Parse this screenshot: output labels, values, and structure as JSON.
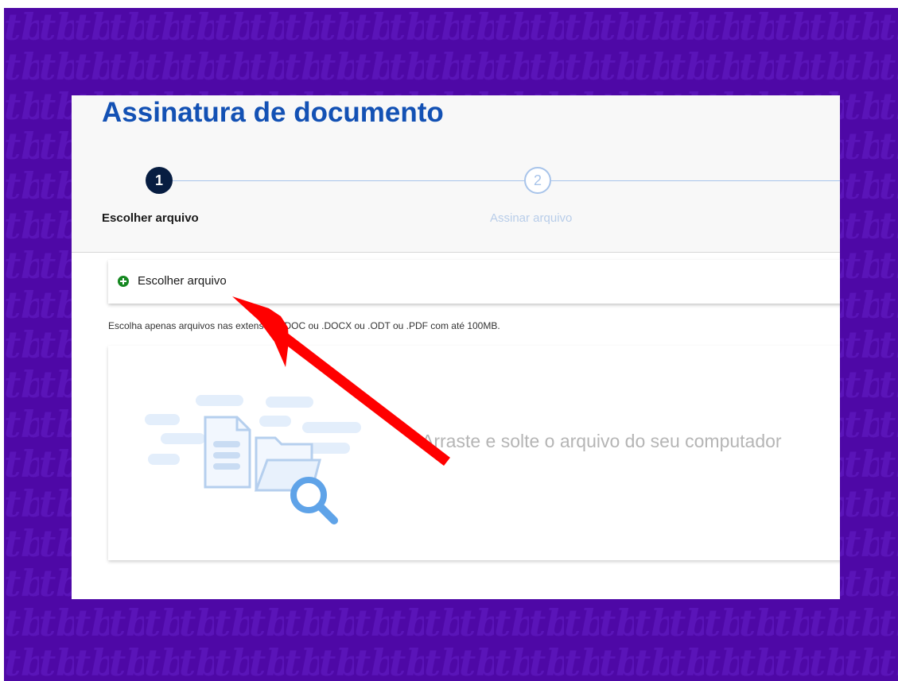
{
  "page": {
    "title": "Assinatura de documento",
    "steps": [
      {
        "number": "1",
        "label": "Escolher arquivo",
        "state": "active"
      },
      {
        "number": "2",
        "label": "Assinar arquivo",
        "state": "inactive"
      }
    ]
  },
  "upload": {
    "choose_label": "Escolher arquivo",
    "hint": "Escolha apenas arquivos nas extensões .DOC ou .DOCX ou .ODT ou .PDF com até 100MB.",
    "dropzone_text": "Arraste e solte o arquivo do seu computador"
  },
  "icons": {
    "choose": "plus-circle-icon",
    "illustration": [
      "document-icon",
      "folder-icon",
      "magnifier-icon"
    ],
    "overlay": "red-arrow"
  },
  "colors": {
    "frame_background": "#4e08a6",
    "title": "#1351b4",
    "step_active": "#071d41",
    "step_inactive": "#a8c4ea",
    "plus_icon": "#168821",
    "arrow": "#ff0000"
  }
}
